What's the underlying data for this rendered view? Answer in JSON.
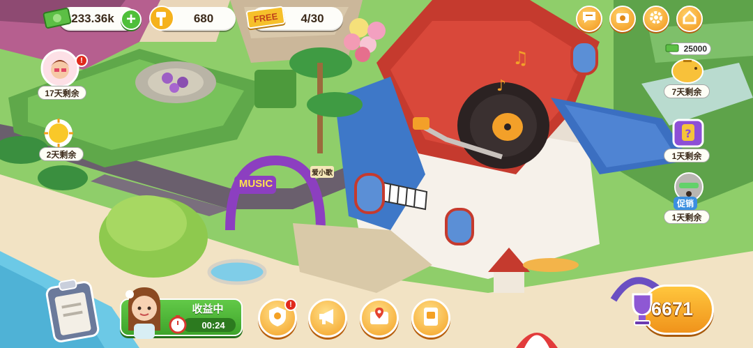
{
  "resources": {
    "cash": "233.36k",
    "hammers": "680",
    "free_tickets_label": "FREE",
    "free_tickets": "4/30"
  },
  "top_menu": {
    "icons": [
      "chat-icon",
      "camera-icon",
      "gear-icon",
      "home-icon"
    ]
  },
  "events_left": [
    {
      "name": "character-event",
      "label": "17天剩余",
      "has_alert": true,
      "alert": "!"
    },
    {
      "name": "sun-event",
      "label": "2天剩余"
    }
  ],
  "events_right": [
    {
      "name": "piggy-bank",
      "amount": "25000",
      "label": "7天剩余"
    },
    {
      "name": "mystery-box",
      "label": "1天剩余"
    },
    {
      "name": "promo-raccoon",
      "badge": "促销",
      "label": "1天剩余"
    }
  ],
  "scene": {
    "music_sign": "MUSIC",
    "shop_sign": "爱小歌"
  },
  "bottom": {
    "income_label": "收益中",
    "income_timer": "00:24",
    "trophy_score": "6671",
    "alert": "!"
  },
  "colors": {
    "grass": "#8fce6a",
    "road": "#6a5f6d",
    "sand": "#f2e3c4",
    "water": "#6cc9e6",
    "roof_red": "#c53a2e",
    "house_blue": "#3b6fc1",
    "accent_orange": "#f4a124",
    "income_green": "#4fb636"
  }
}
